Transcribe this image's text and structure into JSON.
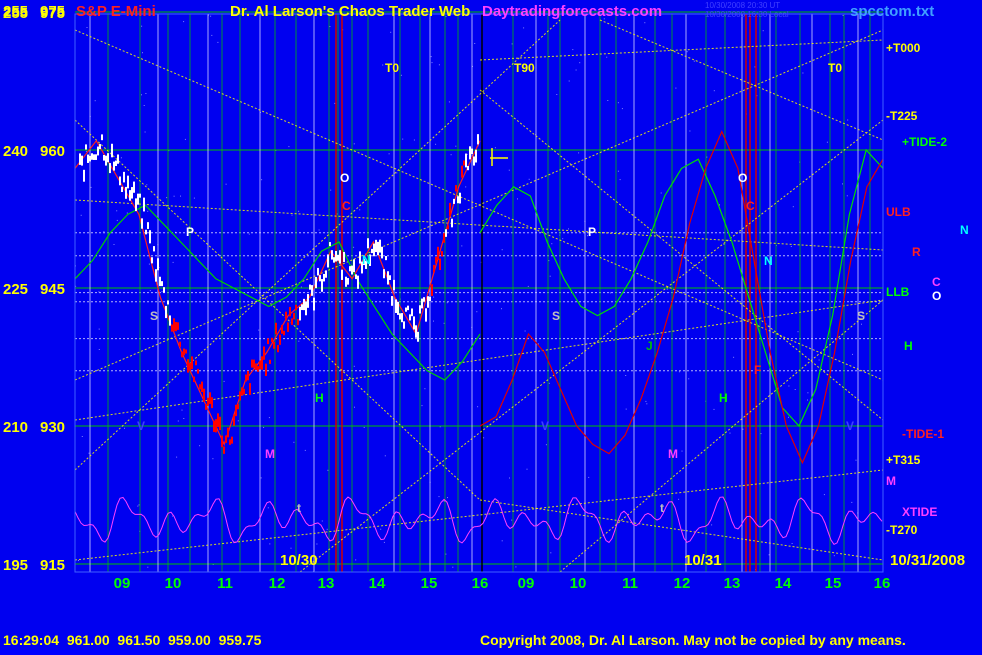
{
  "header": {
    "left_scale": "255",
    "left_price": "975",
    "symbol": "S&P E-Mini",
    "title": "Dr. Al Larson's Chaos Trader Web",
    "site": "Daytradingforecasts.com",
    "stamp_line1": "10/30/2008 20:30 UT",
    "stamp_line2": "10/30/2008 16:30 Local",
    "file": "spcctom.txt"
  },
  "footer": {
    "quote": "16:29:04  961.00  961.50  959.00  959.75",
    "copyright": "Copyright 2008, Dr. Al Larson. May not be copied by any means."
  },
  "colors": {
    "background": "#0000f0",
    "grid_green": "#00c000",
    "grid_white": "#e0e0ff",
    "yellow": "#ffff00",
    "price_white": "#ffffff",
    "price_red": "#ff0000",
    "red_line": "#d00000",
    "green_line": "#00e000",
    "magenta": "#ff40ff"
  },
  "chart_data": {
    "type": "line",
    "y_left_ticks": [
      {
        "scale": "255",
        "price": "975"
      },
      {
        "scale": "240",
        "price": "960"
      },
      {
        "scale": "225",
        "price": "945"
      },
      {
        "scale": "210",
        "price": "930"
      },
      {
        "scale": "195",
        "price": "915"
      }
    ],
    "ylim": [
      915,
      975
    ],
    "x_tick_labels": [
      "09",
      "10",
      "11",
      "12",
      "13",
      "14",
      "15",
      "16",
      "09",
      "10",
      "11",
      "12",
      "13",
      "14",
      "15",
      "16"
    ],
    "date_labels": [
      "10/30",
      "10/31",
      "10/31/2008"
    ],
    "right_labels": [
      {
        "text": "+T000",
        "color": "#ffff00"
      },
      {
        "text": "-T225",
        "color": "#ffff00"
      },
      {
        "text": "+TIDE-2",
        "color": "#00ff00"
      },
      {
        "text": "ULB",
        "color": "#ff2020"
      },
      {
        "text": "R",
        "color": "#ff2020"
      },
      {
        "text": "N",
        "color": "#00ffff"
      },
      {
        "text": "C",
        "color": "#ff40ff"
      },
      {
        "text": "LLB",
        "color": "#00ff00"
      },
      {
        "text": "O",
        "color": "#ffffff"
      },
      {
        "text": "H",
        "color": "#00ff00"
      },
      {
        "text": "-TIDE-1",
        "color": "#ff2020"
      },
      {
        "text": "+T315",
        "color": "#ffff00"
      },
      {
        "text": "M",
        "color": "#ff40ff"
      },
      {
        "text": "XTIDE",
        "color": "#ff40ff"
      },
      {
        "text": "-T270",
        "color": "#ffff00"
      }
    ],
    "markers": [
      {
        "text": "T0",
        "color": "#ffff00"
      },
      {
        "text": "T90",
        "color": "#ffff00"
      },
      {
        "text": "T0",
        "color": "#ffff00"
      },
      {
        "text": "O",
        "color": "#ffffff"
      },
      {
        "text": "C",
        "color": "#ff2020"
      },
      {
        "text": "P",
        "color": "#ffffff"
      },
      {
        "text": "N",
        "color": "#00ffff"
      },
      {
        "text": "S",
        "color": "#c0c0c0"
      },
      {
        "text": "V",
        "color": "#4040ff"
      },
      {
        "text": "M",
        "color": "#ff40ff"
      },
      {
        "text": "H",
        "color": "#00ff00"
      },
      {
        "text": "O",
        "color": "#ffffff"
      },
      {
        "text": "C",
        "color": "#ff2020"
      },
      {
        "text": "P",
        "color": "#ffffff"
      },
      {
        "text": "N",
        "color": "#00ffff"
      },
      {
        "text": "S",
        "color": "#c0c0c0"
      },
      {
        "text": "V",
        "color": "#4040ff"
      },
      {
        "text": "M",
        "color": "#ff40ff"
      },
      {
        "text": "H",
        "color": "#00ff00"
      },
      {
        "text": "J",
        "color": "#00c000"
      },
      {
        "text": "F",
        "color": "#ff2020"
      },
      {
        "text": "S",
        "color": "#c0c0c0"
      },
      {
        "text": "V",
        "color": "#4040ff"
      },
      {
        "text": "t",
        "color": "#c0c0c0"
      },
      {
        "text": "t",
        "color": "#c0c0c0"
      }
    ],
    "series": [
      {
        "values": [
          958,
          961,
          957,
          953,
          944,
          938,
          933,
          928,
          935,
          938,
          942,
          944,
          949,
          946,
          950,
          944,
          940,
          948,
          956,
          961
        ]
      },
      {
        "values": [
          946,
          948,
          951,
          953,
          954,
          952,
          950,
          948,
          946,
          945,
          944,
          943,
          944,
          946,
          949,
          950,
          946,
          943,
          940,
          938,
          936,
          935,
          937,
          940
        ]
      },
      {
        "values": [
          951,
          954,
          956,
          955,
          950,
          946,
          943,
          942,
          943,
          946,
          950,
          955,
          958,
          959,
          955,
          950,
          944,
          938,
          932,
          930,
          934,
          942,
          953,
          960,
          958
        ]
      },
      {
        "values": [
          930,
          931,
          935,
          940,
          938,
          934,
          930,
          928,
          927,
          929,
          933,
          938,
          944,
          952,
          958,
          962,
          958,
          948,
          938,
          930,
          926,
          930,
          938,
          948,
          956,
          959
        ]
      }
    ]
  }
}
